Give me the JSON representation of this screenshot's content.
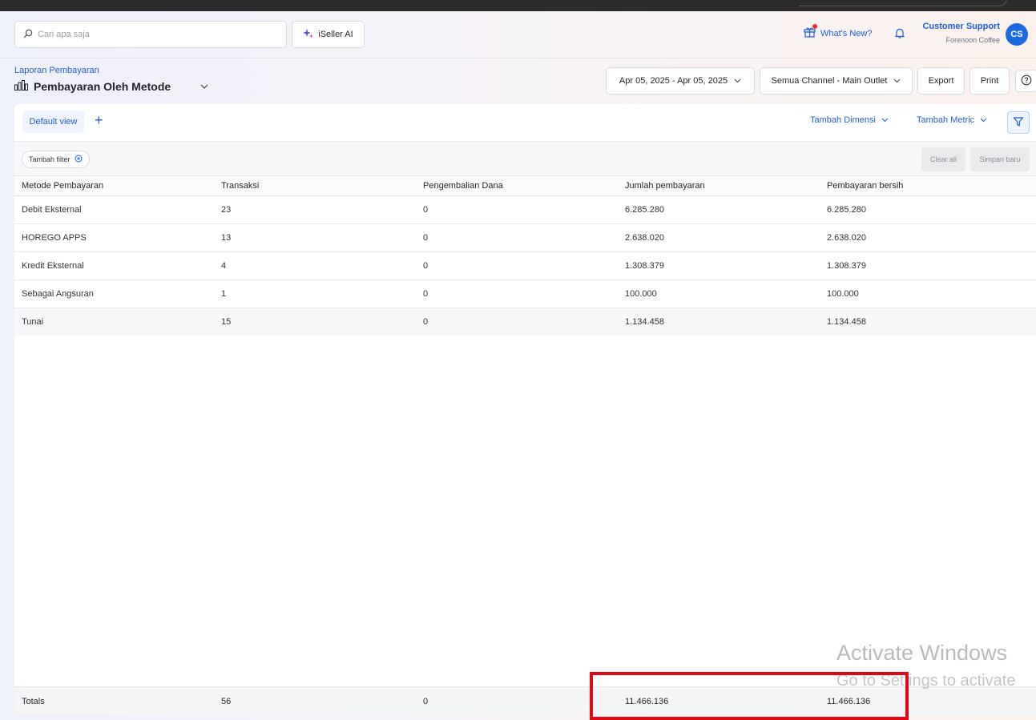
{
  "header": {
    "search_placeholder": "Cari apa saja",
    "ai_button": "iSeller AI",
    "whats_new": "What's New?",
    "user_name": "Customer Support",
    "user_org": "Forenoon Coffee",
    "avatar_initials": "CS"
  },
  "page": {
    "breadcrumb": "Laporan Pembayaran",
    "title": "Pembayaran Oleh Metode",
    "date_range": "Apr 05, 2025 - Apr 05, 2025",
    "channel": "Semua Channel - Main Outlet",
    "export_label": "Export",
    "print_label": "Print"
  },
  "toolbar": {
    "default_view": "Default view",
    "add_dimension": "Tambah Dimensi",
    "add_metric": "Tambah Metric",
    "add_filter": "Tambah filter",
    "clear_all": "Clear all",
    "save_new": "Simpan baru"
  },
  "table": {
    "columns": [
      "Metode Pembayaran",
      "Transaksi",
      "Pengembalian Dana",
      "Jumlah pembayaran",
      "Pembayaran bersih"
    ],
    "rows": [
      [
        "Debit Eksternal",
        "23",
        "0",
        "6.285.280",
        "6.285.280"
      ],
      [
        "HOREGO APPS",
        "13",
        "0",
        "2.638.020",
        "2.638.020"
      ],
      [
        "Kredit Eksternal",
        "4",
        "0",
        "1.308.379",
        "1.308.379"
      ],
      [
        "Sebagai Angsuran",
        "1",
        "0",
        "100.000",
        "100.000"
      ],
      [
        "Tunai",
        "15",
        "0",
        "1.134.458",
        "1.134.458"
      ]
    ],
    "totals": [
      "Totals",
      "56",
      "0",
      "11.466.136",
      "11.466.136"
    ]
  },
  "overlay": {
    "watermark_title": "Activate Windows",
    "watermark_sub": "Go to Settings to activate"
  },
  "colors": {
    "accent": "#1d5fd6",
    "highlight": "#e30613"
  }
}
